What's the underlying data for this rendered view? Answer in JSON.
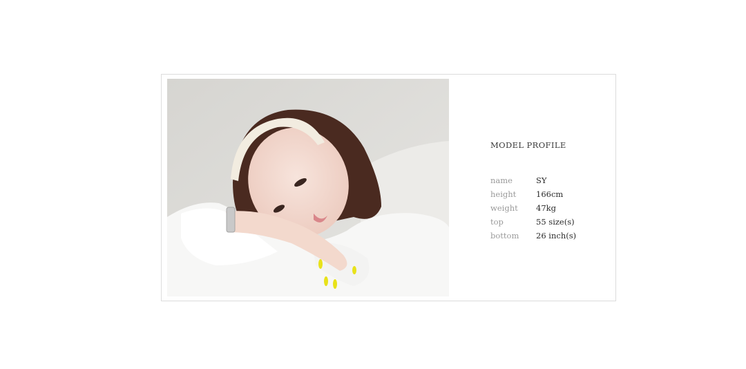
{
  "photo": {
    "alt": "Model photo"
  },
  "profile": {
    "title": "MODEL PROFILE",
    "rows": [
      {
        "key": "name",
        "value": "SY"
      },
      {
        "key": "height",
        "value": "166cm"
      },
      {
        "key": "weight",
        "value": "47kg"
      },
      {
        "key": "top",
        "value": "55 size(s)"
      },
      {
        "key": "bottom",
        "value": "26 inch(s)"
      }
    ]
  }
}
